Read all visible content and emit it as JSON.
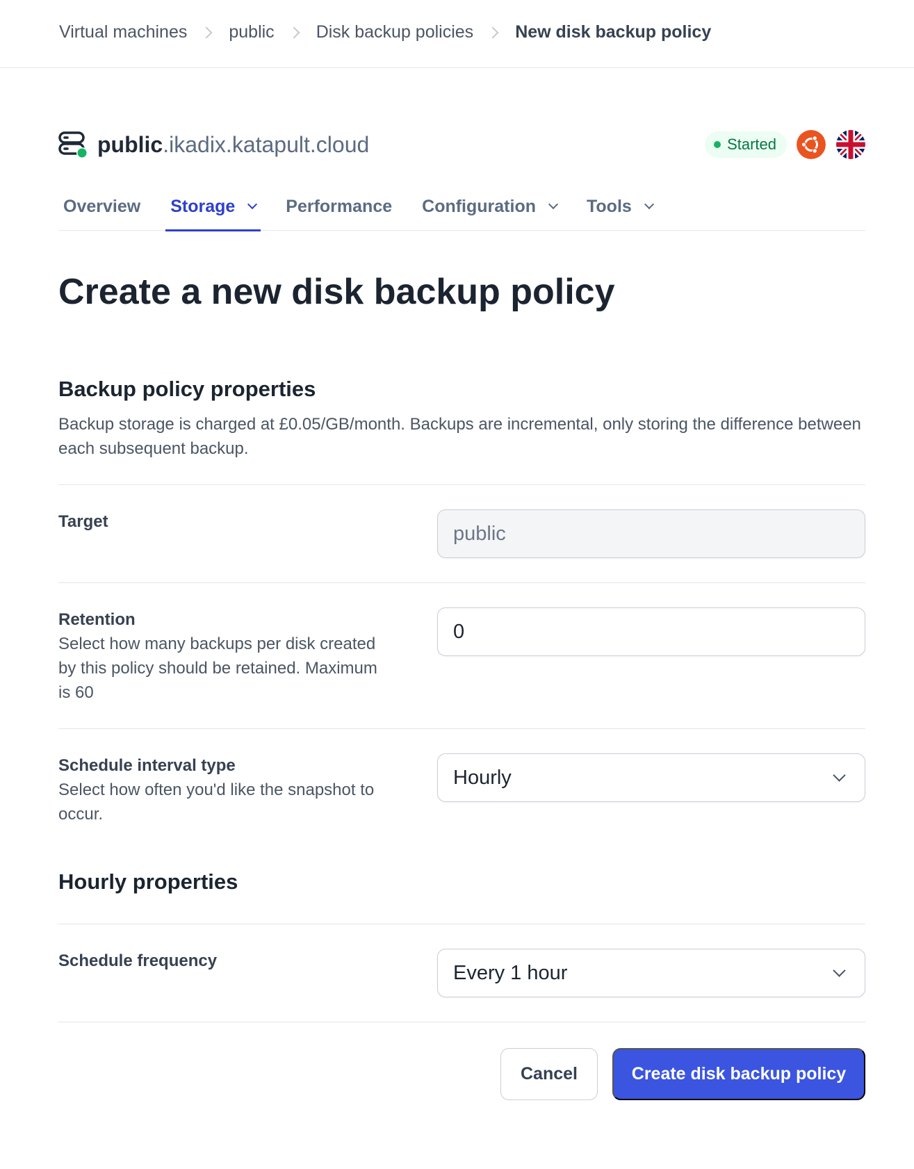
{
  "breadcrumb": {
    "items": [
      {
        "label": "Virtual machines"
      },
      {
        "label": "public"
      },
      {
        "label": "Disk backup policies"
      },
      {
        "label": "New disk backup policy"
      }
    ]
  },
  "vm": {
    "name_primary": "public",
    "name_suffix": ".ikadix.katapult.cloud",
    "status": "Started",
    "os_icon": "ubuntu-logo-icon",
    "region_icon": "uk-flag-icon",
    "colors": {
      "status_bg": "#ecfdf3",
      "status_text": "#067647",
      "status_dot": "#16b364",
      "ubuntu": "#e95420"
    }
  },
  "tabs": [
    {
      "label": "Overview",
      "active": false,
      "has_dropdown": false
    },
    {
      "label": "Storage",
      "active": true,
      "has_dropdown": true
    },
    {
      "label": "Performance",
      "active": false,
      "has_dropdown": false
    },
    {
      "label": "Configuration",
      "active": false,
      "has_dropdown": true
    },
    {
      "label": "Tools",
      "active": false,
      "has_dropdown": true
    }
  ],
  "page": {
    "title": "Create a new disk backup policy"
  },
  "backup_section": {
    "title": "Backup policy properties",
    "description": "Backup storage is charged at £0.05/GB/month. Backups are incremental, only storing the difference between each subsequent backup."
  },
  "fields": {
    "target": {
      "label": "Target",
      "value": "public",
      "disabled": true
    },
    "retention": {
      "label": "Retention",
      "help": "Select how many backups per disk created by this policy should be retained. Maximum is 60",
      "value": "0"
    },
    "schedule_interval_type": {
      "label": "Schedule interval type",
      "help": "Select how often you'd like the snapshot to occur.",
      "value": "Hourly"
    }
  },
  "hourly_section": {
    "title": "Hourly properties",
    "schedule_frequency": {
      "label": "Schedule frequency",
      "value": "Every 1 hour"
    }
  },
  "actions": {
    "cancel_label": "Cancel",
    "submit_label": "Create disk backup policy",
    "accent": "#3b55e0"
  }
}
